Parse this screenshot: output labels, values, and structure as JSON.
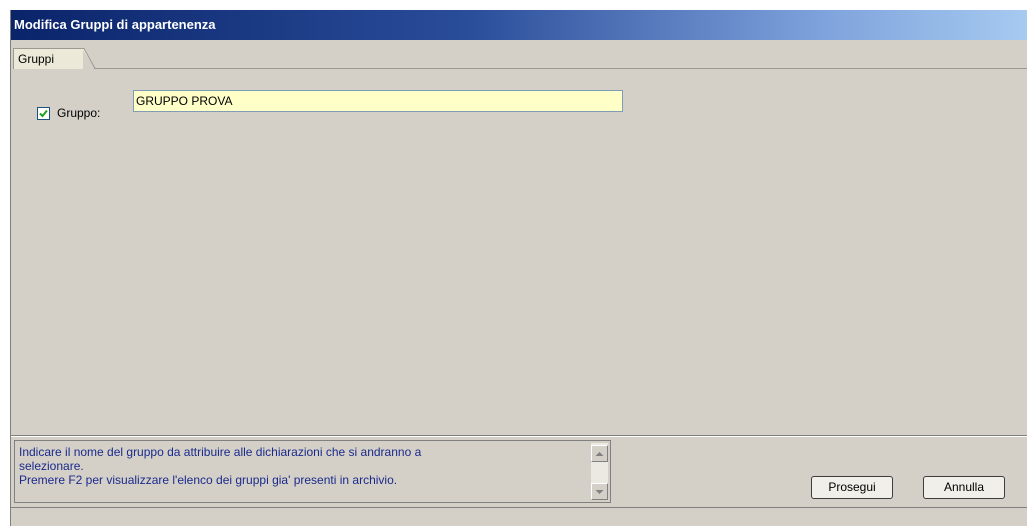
{
  "window": {
    "title": "Modifica Gruppi di appartenenza"
  },
  "tabs": [
    {
      "label": "Gruppi",
      "active": true
    }
  ],
  "form": {
    "group_checkbox": {
      "label": "Gruppo:",
      "checked": true
    },
    "group_input": {
      "value": "GRUPPO PROVA"
    }
  },
  "hint": {
    "line1": "Indicare il nome del gruppo da attribuire alle dichiarazioni che si andranno a",
    "line2": "selezionare.",
    "line3": "Premere F2 per visualizzare l'elenco dei gruppi gia' presenti in archivio."
  },
  "buttons": {
    "next_label": "Prosegui",
    "cancel_label": "Annulla"
  },
  "icons": {
    "check": "check-icon",
    "scroll_up": "arrow-up-icon",
    "scroll_down": "arrow-down-icon"
  },
  "colors": {
    "title_gradient_start": "#0a246a",
    "title_gradient_end": "#a6caf0",
    "input_background": "#ffffc8",
    "hint_text": "#1a2a8c",
    "checkmark": "#21a121"
  }
}
